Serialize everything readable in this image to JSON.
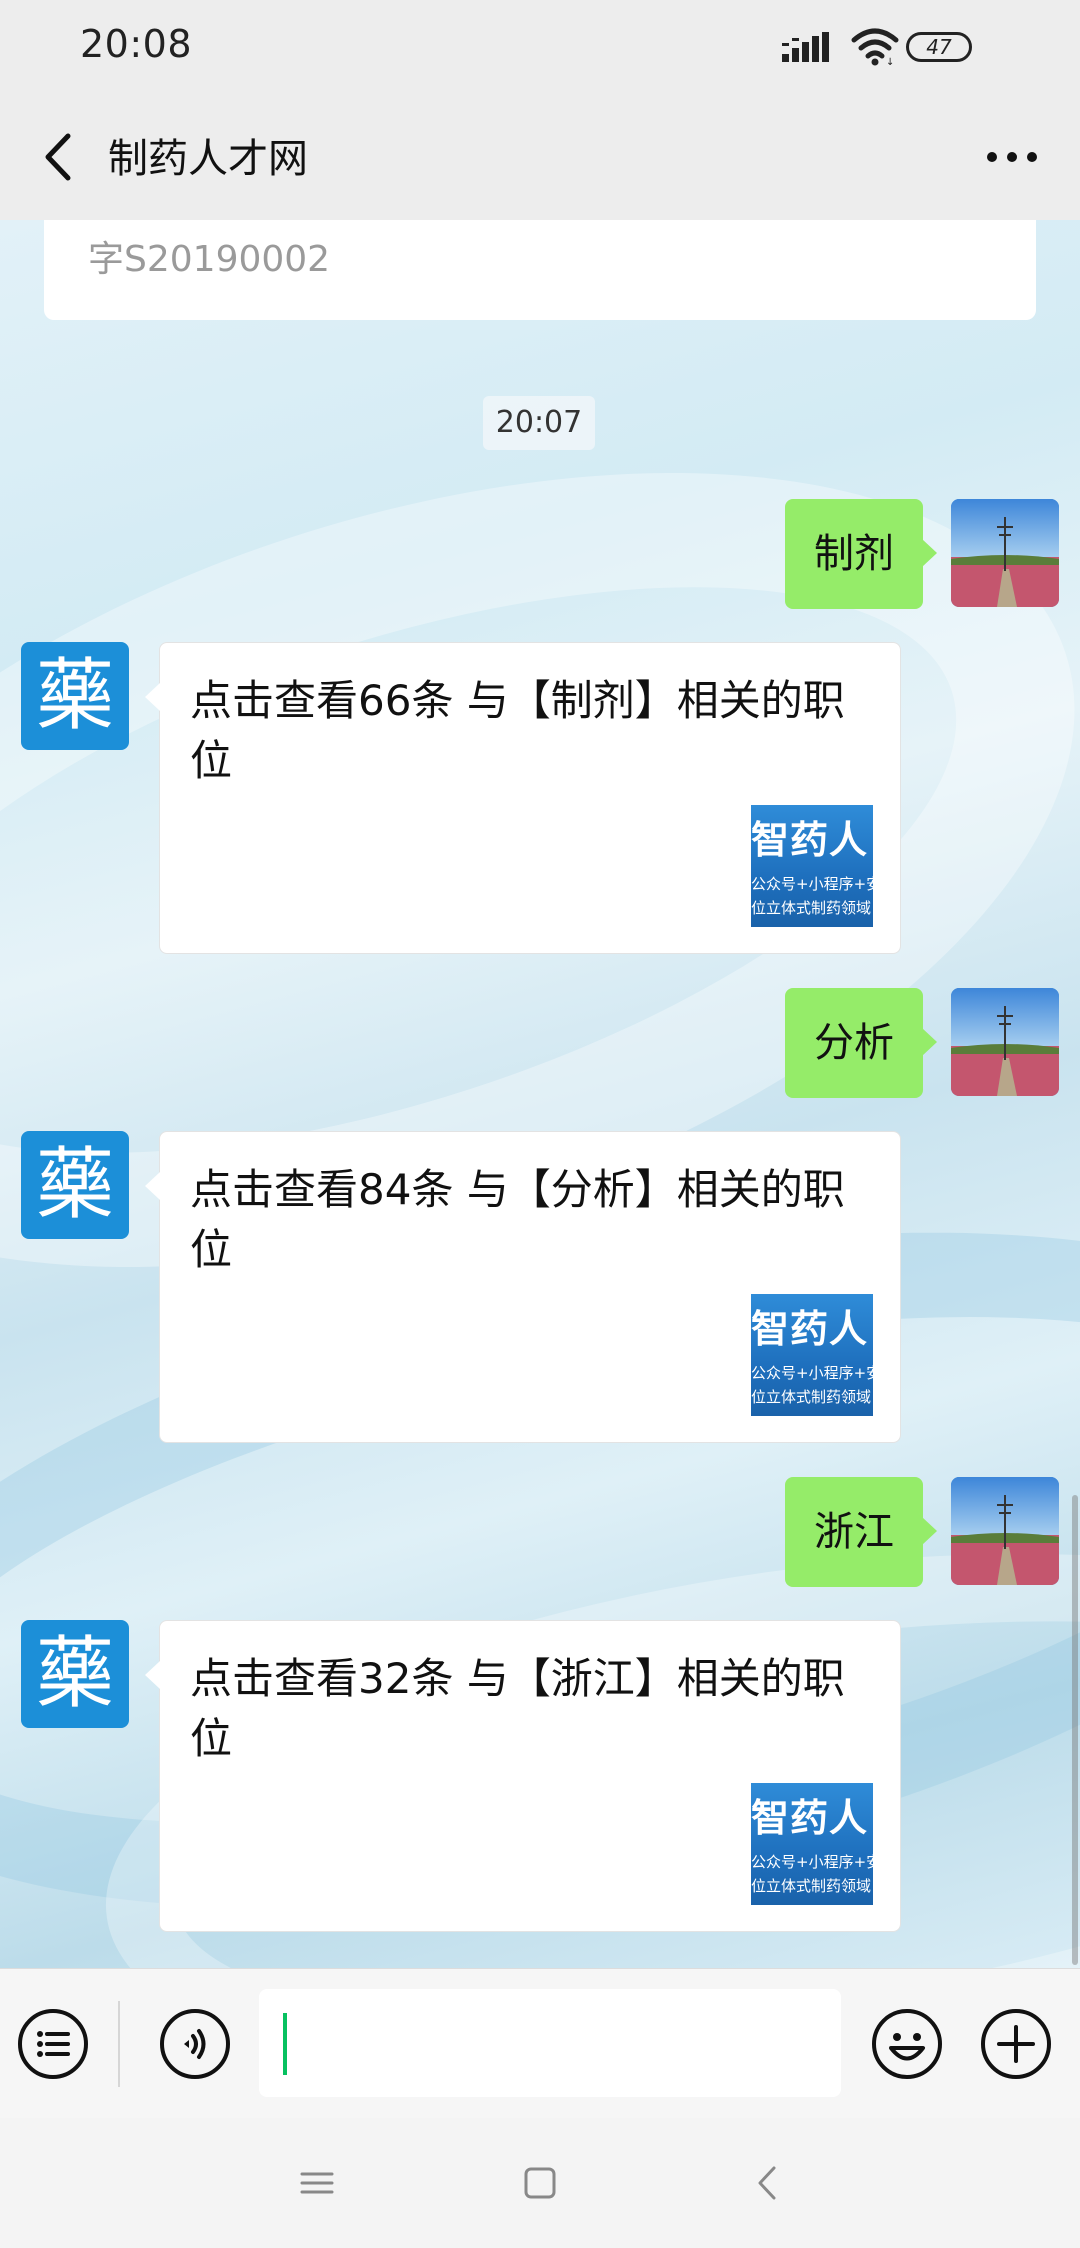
{
  "status_bar": {
    "time": "20:08",
    "battery": "47",
    "icons": [
      "signal-icon",
      "wifi-icon",
      "battery-icon"
    ]
  },
  "header": {
    "title": "制药人才网",
    "back_icon": "chevron-left-icon",
    "more_icon": "more-dots-icon"
  },
  "chat": {
    "previous_card_text": "字S20190002",
    "timestamp": "20:07",
    "bot_avatar_glyph": "藥",
    "messages": [
      {
        "type": "sent",
        "text": "制剂"
      },
      {
        "type": "received",
        "text": "点击查看66条 与【制剂】相关的职位",
        "thumb_title": "智药人",
        "thumb_line1": "公众号+小程序+安",
        "thumb_line2": "位立体式制药领域"
      },
      {
        "type": "sent",
        "text": "分析"
      },
      {
        "type": "received",
        "text": "点击查看84条 与【分析】相关的职位",
        "thumb_title": "智药人",
        "thumb_line1": "公众号+小程序+安",
        "thumb_line2": "位立体式制药领域"
      },
      {
        "type": "sent",
        "text": "浙江"
      },
      {
        "type": "received",
        "text": "点击查看32条 与【浙江】相关的职位",
        "thumb_title": "智药人",
        "thumb_line1": "公众号+小程序+安",
        "thumb_line2": "位立体式制药领域"
      }
    ]
  },
  "input_bar": {
    "value": "",
    "icons": [
      "menu-list-icon",
      "voice-icon",
      "emoji-icon",
      "plus-icon"
    ]
  },
  "nav_bar": {
    "icons": [
      "recents-icon",
      "home-icon",
      "back-icon"
    ]
  },
  "colors": {
    "sent_bubble": "#95ec69",
    "bot_avatar": "#1c8fd8",
    "caret": "#07c160",
    "bar_background": "#ededed"
  }
}
